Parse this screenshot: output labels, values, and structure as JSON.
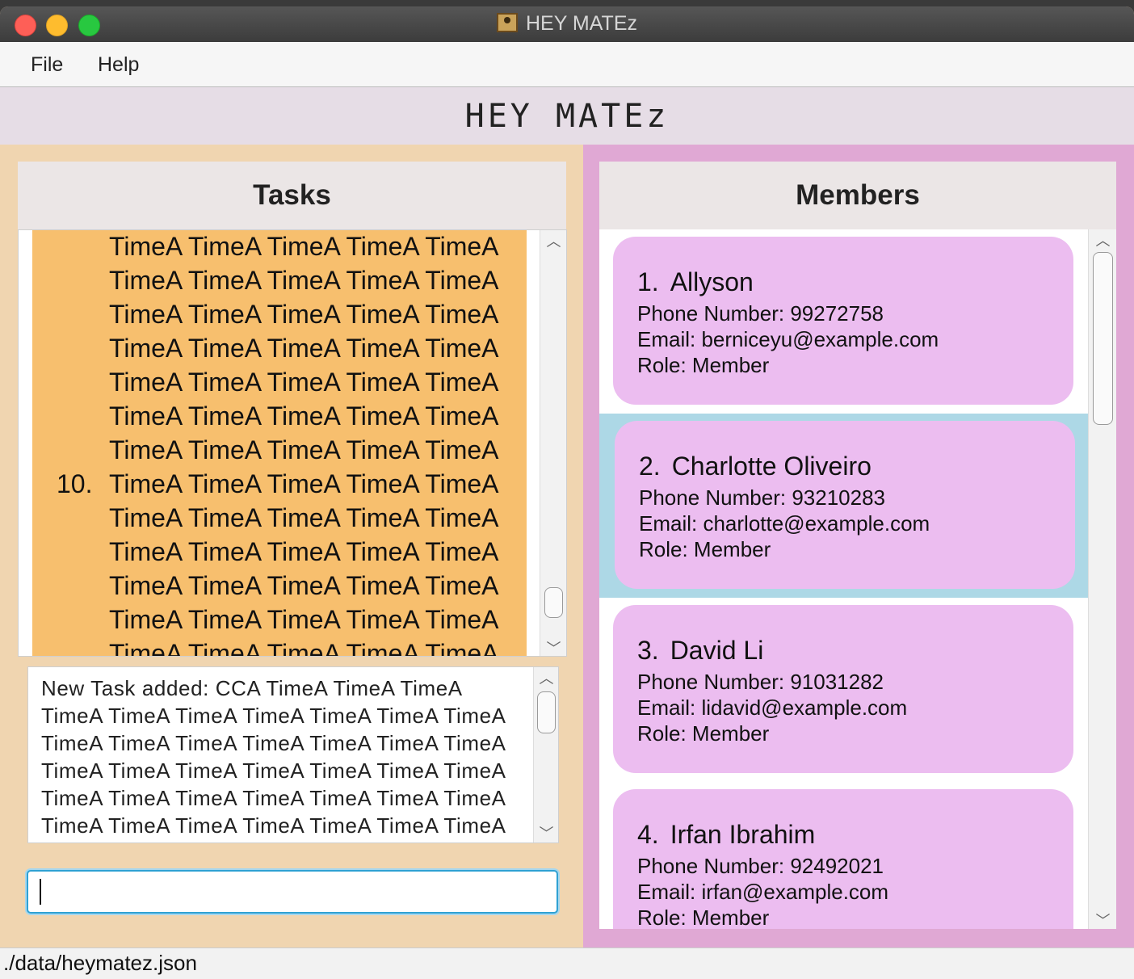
{
  "window": {
    "title": "HEY MATEz"
  },
  "menu": {
    "items": [
      "File",
      "Help"
    ]
  },
  "header": {
    "title": "HEY MATEz"
  },
  "tasks": {
    "title": "Tasks",
    "lines": [
      "TimeA TimeA TimeA TimeA TimeA",
      "TimeA TimeA TimeA TimeA TimeA",
      "TimeA TimeA TimeA TimeA TimeA",
      "TimeA TimeA TimeA TimeA TimeA",
      "TimeA TimeA TimeA TimeA TimeA",
      "TimeA TimeA TimeA TimeA TimeA",
      "TimeA TimeA TimeA TimeA TimeA",
      "TimeA TimeA TimeA TimeA TimeA",
      "TimeA TimeA TimeA TimeA TimeA",
      "TimeA TimeA TimeA TimeA TimeA",
      "TimeA TimeA TimeA TimeA TimeA",
      "TimeA TimeA TimeA TimeA TimeA",
      "TimeA TimeA TimeA TimeA TimeA"
    ],
    "index_label": "10."
  },
  "result": {
    "lines": [
      "New Task added: CCA TimeA TimeA TimeA",
      "TimeA TimeA TimeA TimeA TimeA TimeA TimeA",
      "TimeA TimeA TimeA TimeA TimeA TimeA TimeA",
      "TimeA TimeA TimeA TimeA TimeA TimeA TimeA",
      "TimeA TimeA TimeA TimeA TimeA TimeA TimeA",
      "TimeA TimeA TimeA TimeA TimeA TimeA TimeA"
    ]
  },
  "command": {
    "value": ""
  },
  "members": {
    "title": "Members",
    "list": [
      {
        "index": "1.",
        "name": "Allyson",
        "phone": "Phone Number: 99272758",
        "email": "Email: berniceyu@example.com",
        "role": "Role: Member"
      },
      {
        "index": "2.",
        "name": "Charlotte Oliveiro",
        "phone": "Phone Number: 93210283",
        "email": "Email: charlotte@example.com",
        "role": "Role: Member"
      },
      {
        "index": "3.",
        "name": "David Li",
        "phone": "Phone Number: 91031282",
        "email": "Email: lidavid@example.com",
        "role": "Role: Member"
      },
      {
        "index": "4.",
        "name": "Irfan Ibrahim",
        "phone": "Phone Number: 92492021",
        "email": "Email: irfan@example.com",
        "role": "Role: Member"
      }
    ],
    "selected_index": 1
  },
  "status": {
    "path": "./data/heymatez.json"
  },
  "colors": {
    "task_card": "#f7bf6e",
    "member_card": "#ecbdf0",
    "selected_row": "#add8e6",
    "left_bg": "#f0d5b0",
    "right_bg": "#e0a8d4"
  }
}
